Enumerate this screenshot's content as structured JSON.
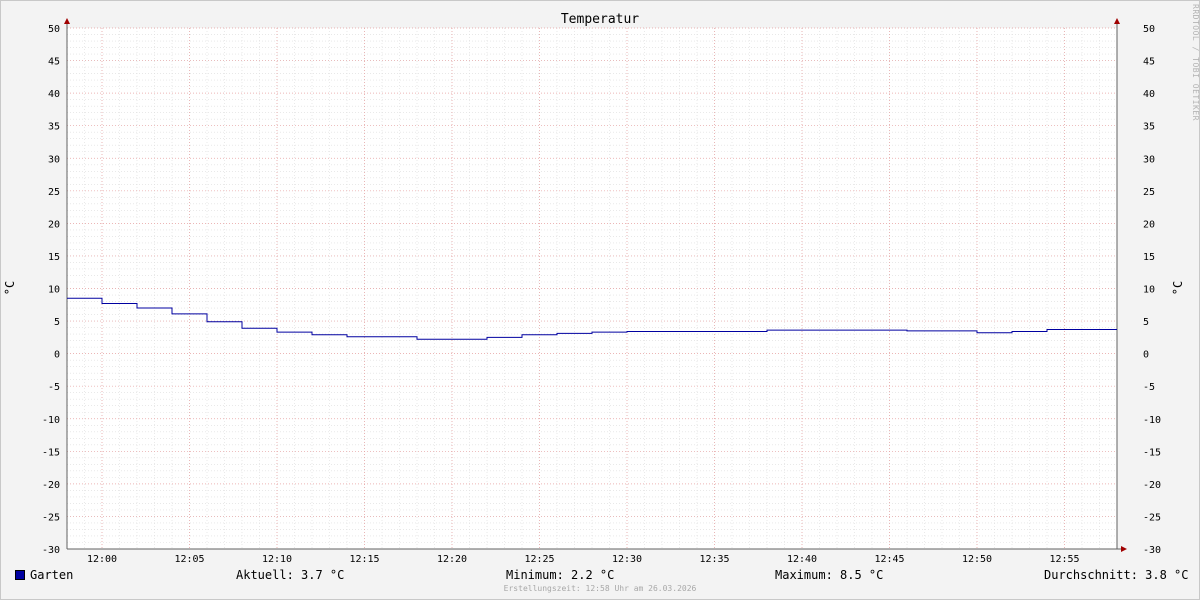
{
  "chart_data": {
    "type": "line",
    "title": "Temperatur",
    "ylabel_left": "°C",
    "ylabel_right": "°C",
    "ylim": [
      -30,
      50
    ],
    "yticks": [
      50,
      45,
      40,
      35,
      30,
      25,
      20,
      15,
      10,
      5,
      0,
      -5,
      -10,
      -15,
      -20,
      -25,
      -30
    ],
    "xticks": [
      "12:00",
      "12:05",
      "12:10",
      "12:15",
      "12:20",
      "12:25",
      "12:30",
      "12:35",
      "12:40",
      "12:45",
      "12:50",
      "12:55"
    ],
    "grid": true,
    "x_unit": "minutes after 11:58",
    "series": [
      {
        "name": "Garten",
        "color": "#0000a0",
        "x": [
          0,
          2,
          4,
          6,
          8,
          10,
          12,
          14,
          16,
          18,
          20,
          22,
          24,
          26,
          28,
          30,
          32,
          34,
          36,
          38,
          40,
          42,
          44,
          46,
          48,
          50,
          52,
          54,
          56,
          58,
          60
        ],
        "values": [
          8.5,
          7.7,
          7.0,
          6.1,
          4.9,
          3.9,
          3.3,
          2.9,
          2.6,
          2.6,
          2.2,
          2.2,
          2.5,
          2.9,
          3.1,
          3.3,
          3.4,
          3.4,
          3.4,
          3.4,
          3.6,
          3.6,
          3.6,
          3.6,
          3.5,
          3.5,
          3.2,
          3.4,
          3.7,
          3.7,
          3.7
        ]
      }
    ]
  },
  "legend": {
    "series_name": "Garten",
    "swatch_color": "#0000a0",
    "current": "Aktuell: 3.7 °C",
    "minimum": "Minimum: 2.2 °C",
    "maximum": "Maximum: 8.5 °C",
    "average": "Durchschnitt: 3.8 °C"
  },
  "footer": "Erstellungszeit: 12:58 Uhr am 26.03.2026",
  "watermark": "RRDTOOL / TOBI OETIKER"
}
